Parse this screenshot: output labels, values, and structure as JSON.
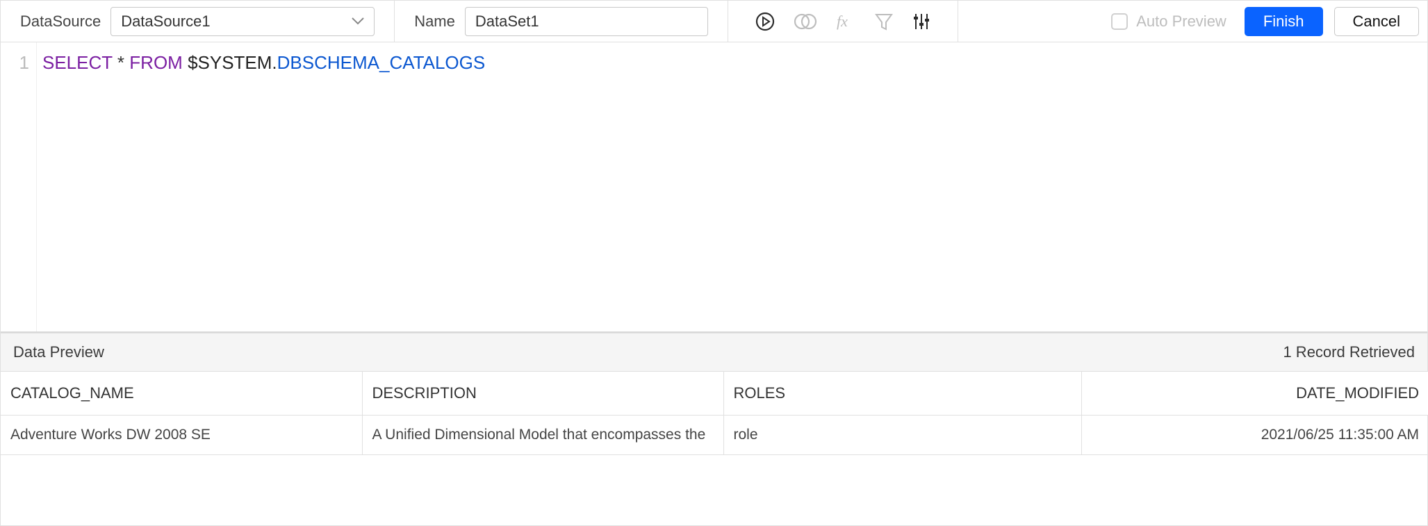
{
  "toolbar": {
    "datasource_label": "DataSource",
    "datasource_value": "DataSource1",
    "name_label": "Name",
    "name_value": "DataSet1",
    "auto_preview_label": "Auto Preview",
    "finish_label": "Finish",
    "cancel_label": "Cancel"
  },
  "icons": {
    "play": "play-icon",
    "join": "join-icon",
    "fx": "fx-icon",
    "filter": "filter-icon",
    "sliders": "sliders-icon"
  },
  "editor": {
    "line_number": "1",
    "query_sql": "SELECT * FROM $SYSTEM.DBSCHEMA_CATALOGS",
    "tokens": {
      "select": "SELECT",
      "star": "*",
      "from": "FROM",
      "system": "$SYSTEM.",
      "catalog": "DBSCHEMA_CATALOGS"
    }
  },
  "preview": {
    "title": "Data Preview",
    "status": "1 Record Retrieved",
    "columns": [
      "CATALOG_NAME",
      "DESCRIPTION",
      "ROLES",
      "DATE_MODIFIED"
    ],
    "rows": [
      {
        "catalog_name": "Adventure Works DW 2008 SE",
        "description": "A Unified Dimensional Model that encompasses the",
        "roles": "role",
        "date_modified": "2021/06/25 11:35:00 AM"
      }
    ]
  }
}
